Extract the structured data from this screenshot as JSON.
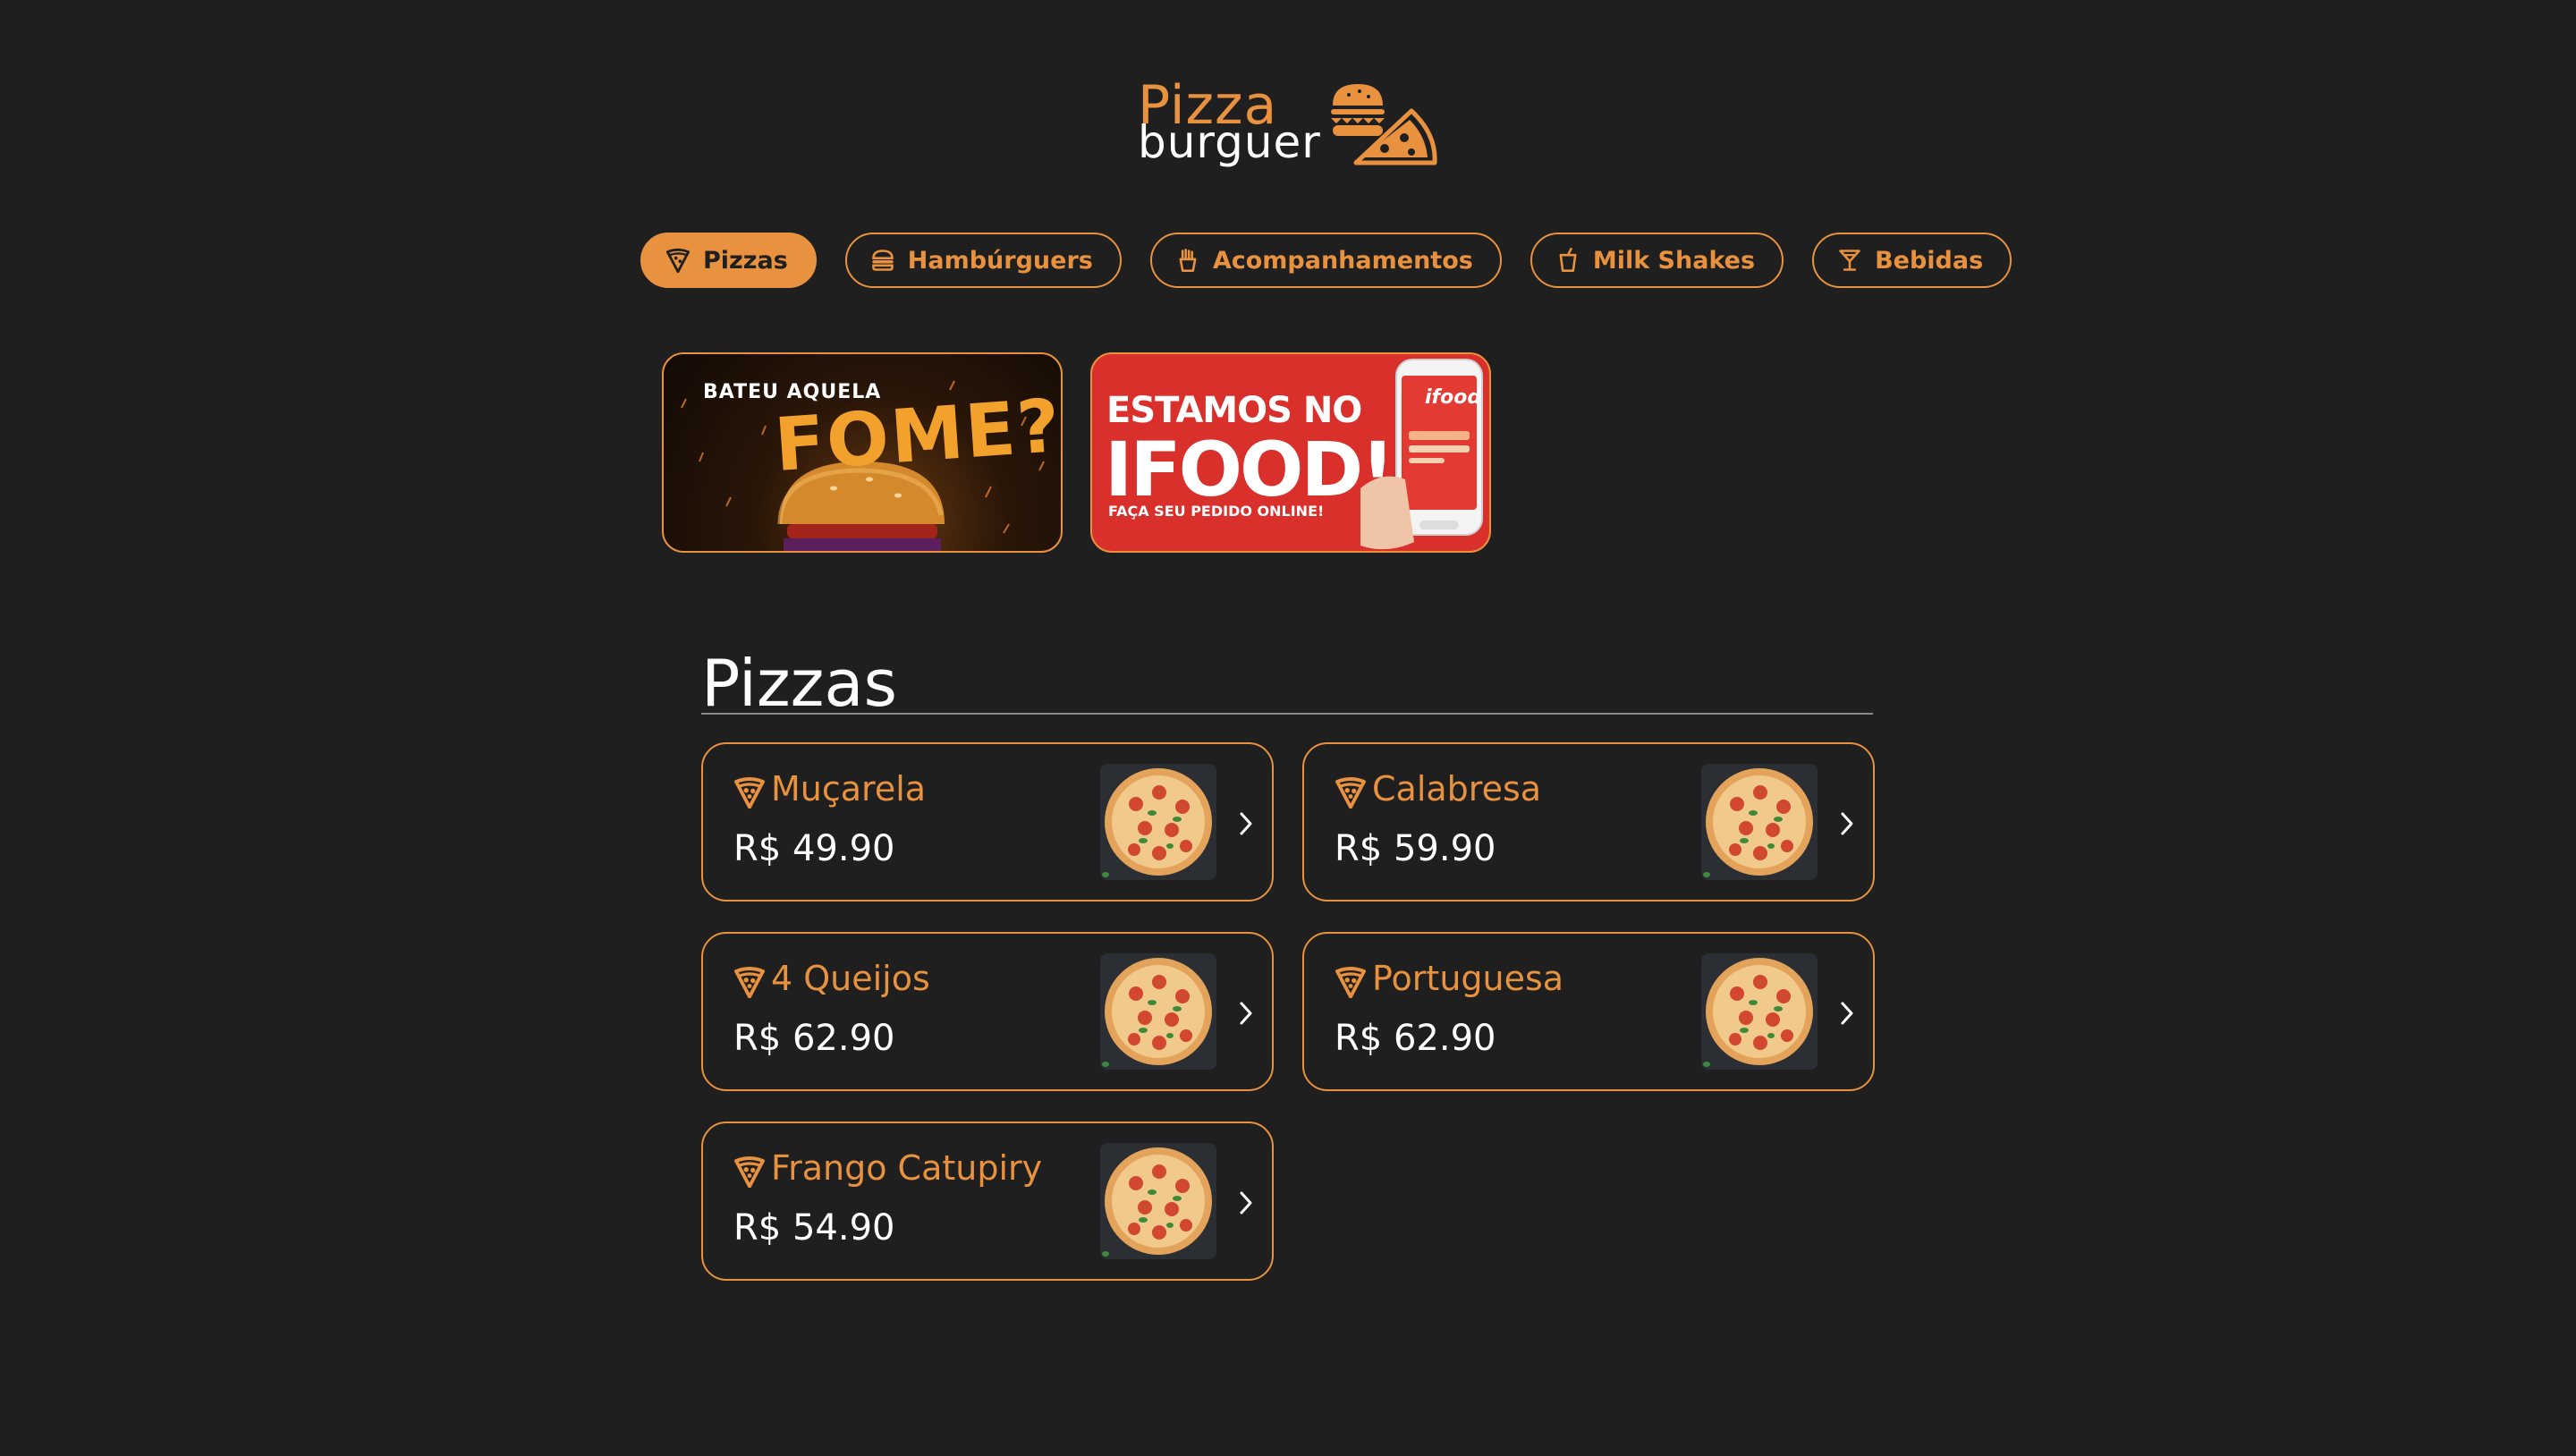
{
  "logo": {
    "line1": "Pizza",
    "line2": "burguer"
  },
  "nav": [
    {
      "label": "Pizzas",
      "icon": "pizza-icon",
      "active": true
    },
    {
      "label": "Hambúrguers",
      "icon": "burger-icon",
      "active": false
    },
    {
      "label": "Acompanhamentos",
      "icon": "fries-icon",
      "active": false
    },
    {
      "label": "Milk Shakes",
      "icon": "cup-icon",
      "active": false
    },
    {
      "label": "Bebidas",
      "icon": "cocktail-icon",
      "active": false
    }
  ],
  "banners": {
    "fome": {
      "line1": "BATEU AQUELA",
      "line2": "FOME?"
    },
    "ifood": {
      "line1": "ESTAMOS NO",
      "line2": "IFOOD!",
      "line3": "FAÇA SEU PEDIDO ONLINE!",
      "logo": "ifood"
    }
  },
  "section": {
    "title": "Pizzas"
  },
  "products": [
    {
      "name": "Muçarela",
      "price": "R$ 49.90"
    },
    {
      "name": "Calabresa",
      "price": "R$ 59.90"
    },
    {
      "name": "4 Queijos",
      "price": "R$ 62.90"
    },
    {
      "name": "Portuguesa",
      "price": "R$ 62.90"
    },
    {
      "name": "Frango Catupiry",
      "price": "R$ 54.90"
    }
  ],
  "colors": {
    "accent": "#e8913e",
    "background": "#1f1f1f",
    "text": "#ffffff"
  }
}
